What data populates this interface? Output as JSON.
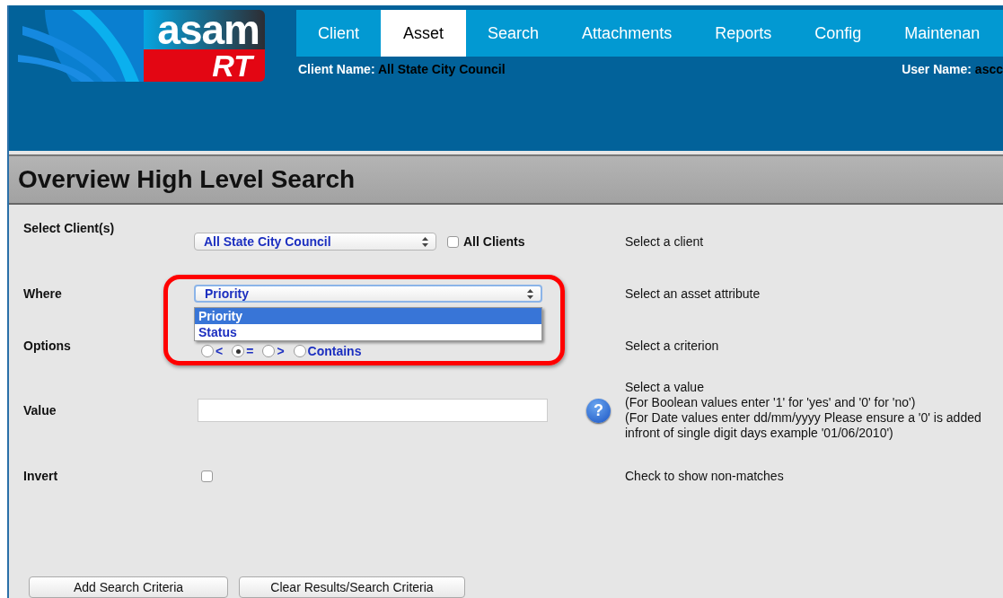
{
  "logo": {
    "word": "asam",
    "badge": "RT"
  },
  "nav": {
    "tabs": [
      {
        "label": "Client",
        "selected": false
      },
      {
        "label": "Asset",
        "selected": true
      },
      {
        "label": "Search",
        "selected": false
      },
      {
        "label": "Attachments",
        "selected": false
      },
      {
        "label": "Reports",
        "selected": false
      },
      {
        "label": "Config",
        "selected": false
      },
      {
        "label": "Maintenan",
        "selected": false
      }
    ]
  },
  "client_name": {
    "label": "Client Name:",
    "value": "All State City Council"
  },
  "user_name": {
    "label": "User Name:",
    "value": "ascc"
  },
  "page_title": "Overview High Level Search",
  "client_row": {
    "label": "Select Client(s)",
    "value": "All State City Council",
    "all_clients": {
      "label": "All Clients",
      "checked": false
    },
    "help": "Select a client"
  },
  "where_row": {
    "label": "Where",
    "value": "Priority",
    "expanded": true,
    "options": [
      {
        "label": "Priority",
        "selected": true
      },
      {
        "label": "Status",
        "selected": false
      }
    ],
    "help": "Select an asset attribute"
  },
  "options_row": {
    "label": "Options",
    "radios": [
      {
        "label": "<",
        "selected": false
      },
      {
        "label": "=",
        "selected": true
      },
      {
        "label": ">",
        "selected": false
      },
      {
        "label": "Contains",
        "selected": false
      }
    ],
    "help": "Select a criterion"
  },
  "value_row": {
    "label": "Value",
    "help_icon": "?",
    "help_lines": [
      "Select a value",
      "(For Boolean values enter '1' for 'yes' and '0' for 'no')",
      "(For Date values enter dd/mm/yyyy Please ensure a '0'  is added infront of single digit days example '01/06/2010')"
    ]
  },
  "invert_row": {
    "label": "Invert",
    "checked": false,
    "help": "Check to show non-matches"
  },
  "buttons": [
    "Add Search Criteria",
    "Clear Results/Search Criteria"
  ],
  "highlight": true
}
